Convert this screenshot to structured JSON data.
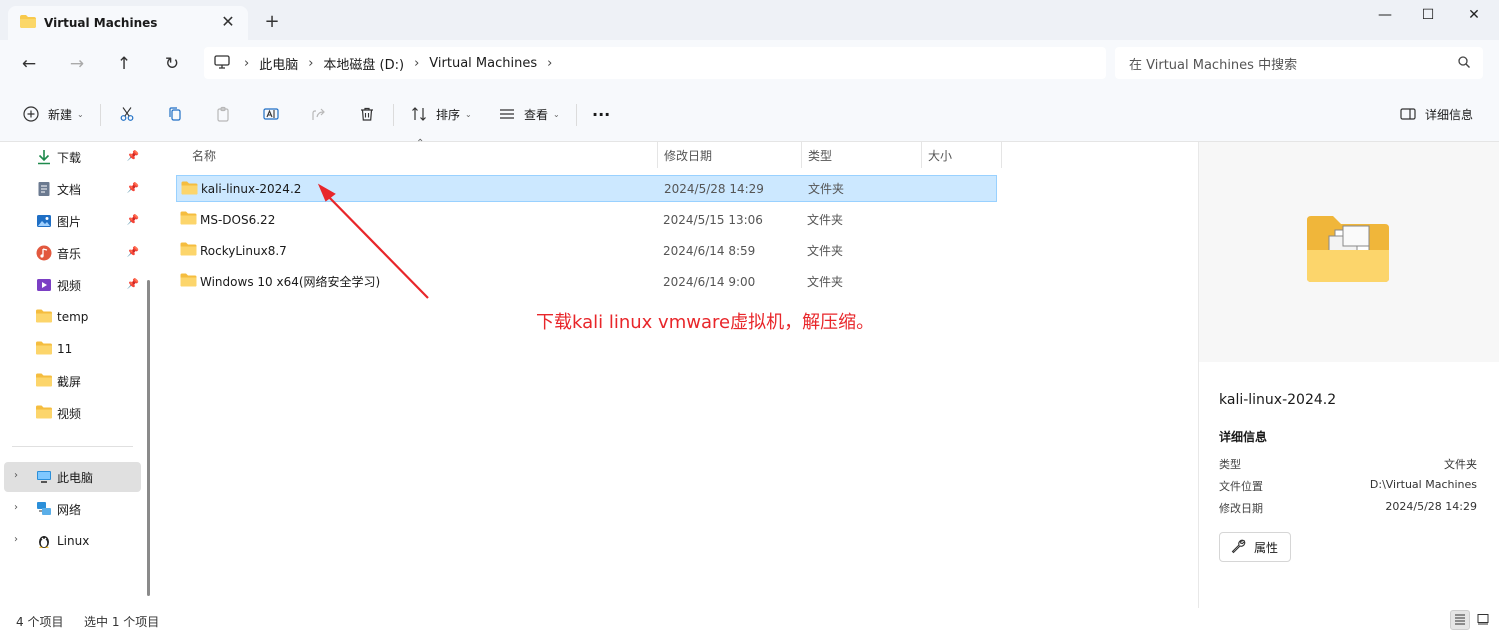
{
  "window": {
    "tab_title": "Virtual Machines",
    "new_tab": "+",
    "minimize": "—",
    "maximize": "☐",
    "close": "✕"
  },
  "navigation": {
    "back": "←",
    "forward": "→",
    "up": "↑",
    "refresh": "↻",
    "breadcrumbs": [
      "此电脑",
      "本地磁盘 (D:)",
      "Virtual Machines"
    ],
    "search_placeholder": "在 Virtual Machines 中搜索"
  },
  "toolbar": {
    "new_label": "新建",
    "sort_label": "排序",
    "view_label": "查看",
    "more_label": "···",
    "details_label": "详细信息"
  },
  "sidebar": {
    "items": [
      {
        "label": "下载",
        "icon": "download-icon",
        "pinned": true
      },
      {
        "label": "文档",
        "icon": "document-icon",
        "pinned": true
      },
      {
        "label": "图片",
        "icon": "picture-icon",
        "pinned": true
      },
      {
        "label": "音乐",
        "icon": "music-icon",
        "pinned": true
      },
      {
        "label": "视频",
        "icon": "video-icon",
        "pinned": true
      },
      {
        "label": "temp",
        "icon": "folder-icon",
        "pinned": false
      },
      {
        "label": "11",
        "icon": "folder-icon",
        "pinned": false
      },
      {
        "label": "截屏",
        "icon": "folder-icon",
        "pinned": false
      },
      {
        "label": "视频",
        "icon": "folder-icon",
        "pinned": false
      }
    ],
    "roots": [
      {
        "label": "此电脑",
        "icon": "computer-icon",
        "selected": true
      },
      {
        "label": "网络",
        "icon": "network-icon",
        "selected": false
      },
      {
        "label": "Linux",
        "icon": "linux-icon",
        "selected": false
      }
    ]
  },
  "filelist": {
    "columns": {
      "name": "名称",
      "date": "修改日期",
      "type": "类型",
      "size": "大小"
    },
    "rows": [
      {
        "name": "kali-linux-2024.2",
        "date": "2024/5/28 14:29",
        "type": "文件夹",
        "selected": true
      },
      {
        "name": "MS-DOS6.22",
        "date": "2024/5/15 13:06",
        "type": "文件夹",
        "selected": false
      },
      {
        "name": "RockyLinux8.7",
        "date": "2024/6/14 8:59",
        "type": "文件夹",
        "selected": false
      },
      {
        "name": "Windows 10 x64(网络安全学习)",
        "date": "2024/6/14 9:00",
        "type": "文件夹",
        "selected": false
      }
    ],
    "annotation": "下载kali linux vmware虚拟机，解压缩。"
  },
  "details": {
    "name": "kali-linux-2024.2",
    "section": "详细信息",
    "fields": [
      {
        "key": "类型",
        "value": "文件夹"
      },
      {
        "key": "文件位置",
        "value": "D:\\Virtual Machines"
      },
      {
        "key": "修改日期",
        "value": "2024/5/28 14:29"
      }
    ],
    "properties_label": "属性"
  },
  "status": {
    "item_count": "4 个项目",
    "selected_count": "选中 1 个项目"
  },
  "colors": {
    "accent_selected": "#cce8ff",
    "folder_yellow": "#f8c94c",
    "annotation_red": "#e8262a"
  }
}
